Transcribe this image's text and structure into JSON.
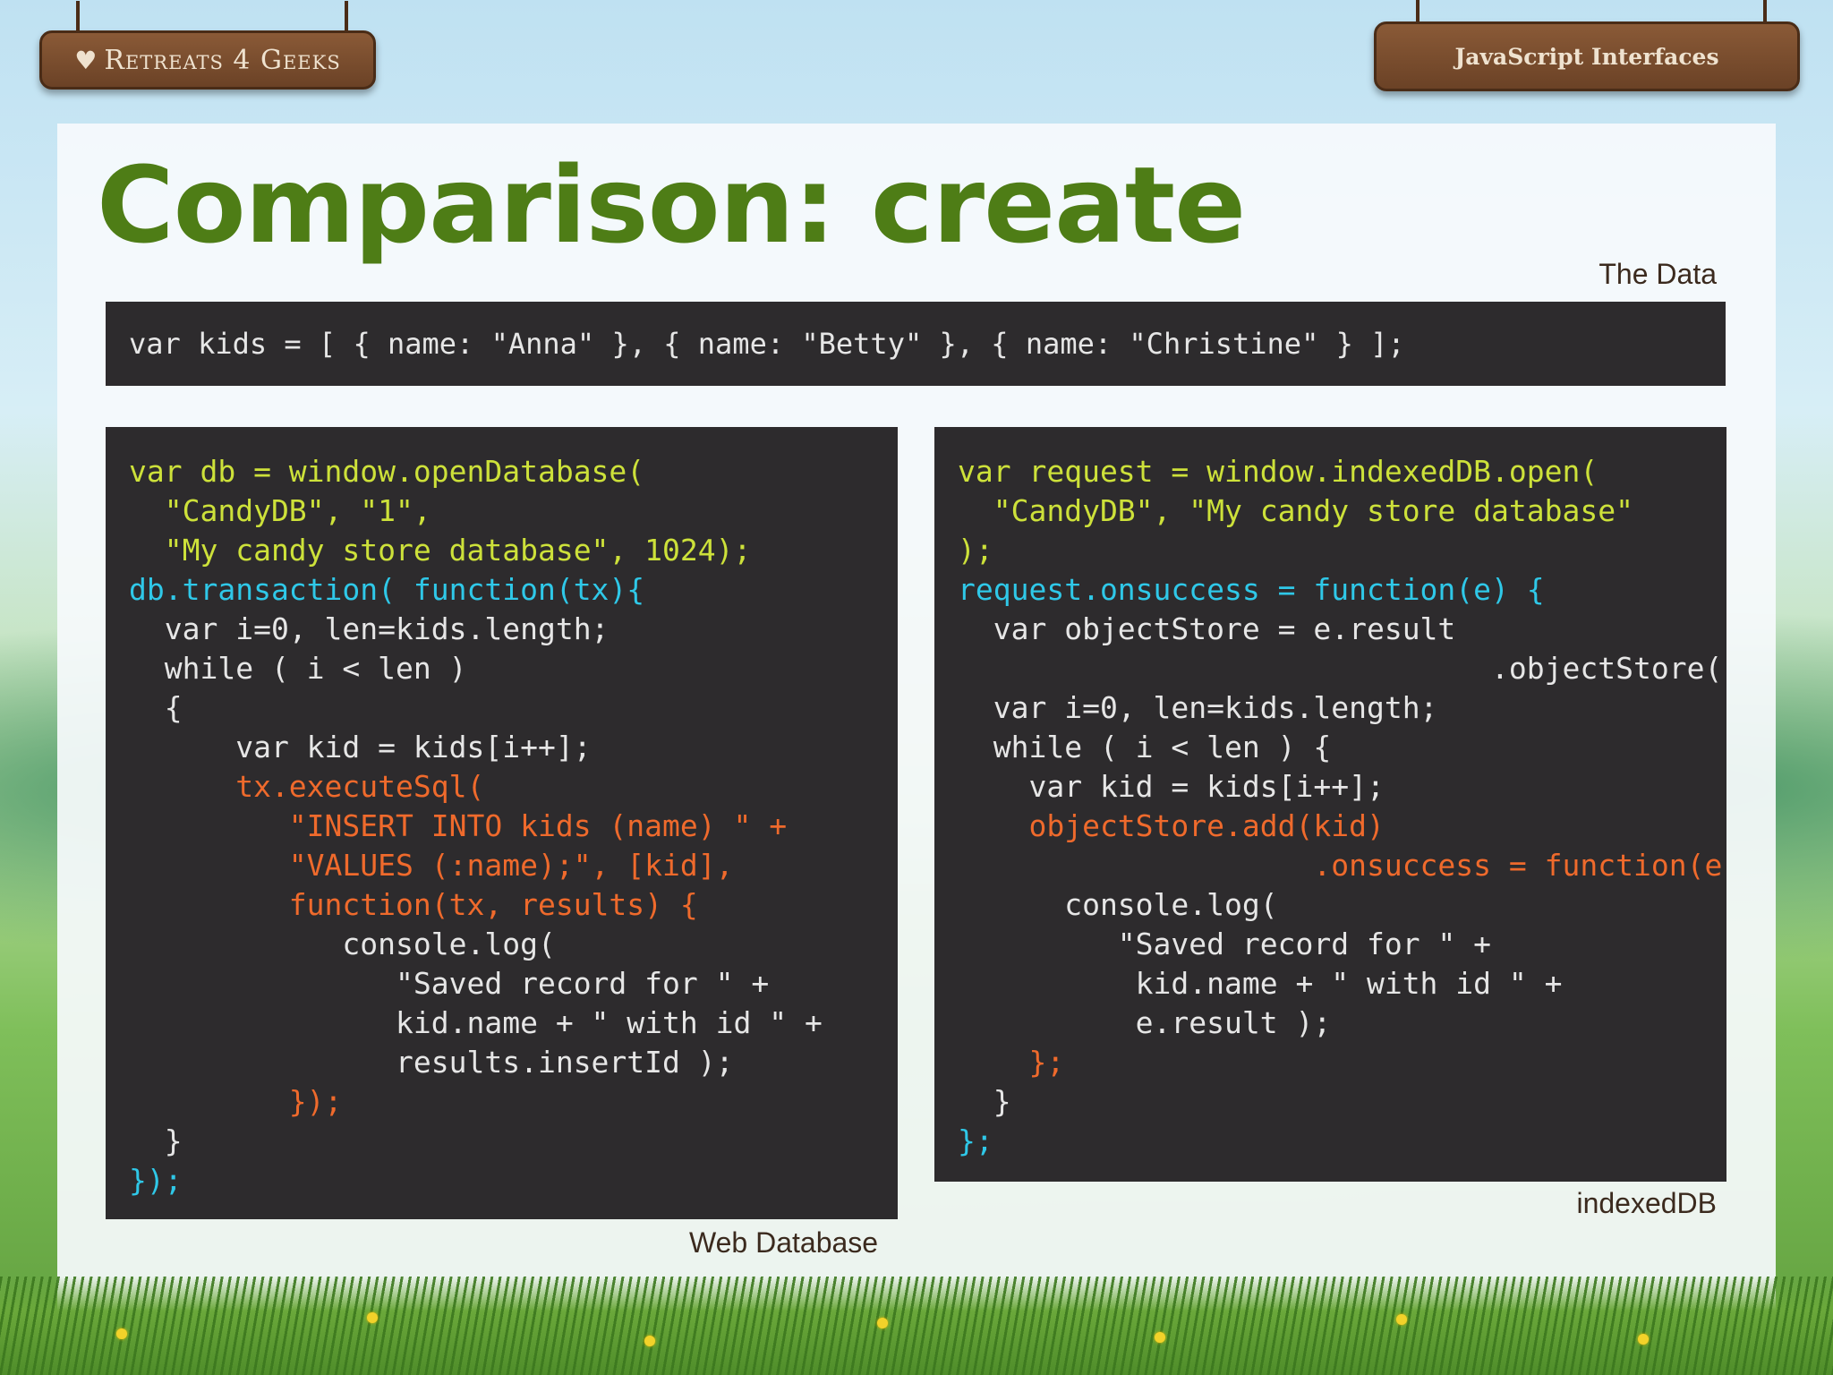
{
  "header": {
    "logo_text": "Retreats 4 Geeks",
    "topic": "JavaScript Interfaces"
  },
  "slide": {
    "title": "Comparison: create",
    "caption_data": "The Data",
    "caption_web": "Web Database",
    "caption_idb": "indexedDB"
  },
  "code_data": {
    "line": "var kids = [ { name: \"Anna\" }, { name: \"Betty\" }, { name: \"Christine\" } ];"
  },
  "code_web": {
    "lines": [
      "var db = window.openDatabase(",
      "  \"CandyDB\", \"1\",",
      "  \"My candy store database\", 1024);",
      "db.transaction( function(tx){",
      "  var i=0, len=kids.length;",
      "  while ( i < len )",
      "  {",
      "      var kid = kids[i++];",
      "      tx.executeSql(",
      "         \"INSERT INTO kids (name) \" +",
      "         \"VALUES (:name);\", [kid],",
      "         function(tx, results) {",
      "            console.log(",
      "               \"Saved record for \" +",
      "               kid.name + \" with id \" +",
      "               results.insertId );",
      "         });",
      "  }",
      "});"
    ]
  },
  "code_idb": {
    "lines": [
      "var request = window.indexedDB.open(",
      "  \"CandyDB\", \"My candy store database\"",
      ");",
      "request.onsuccess = function(e) {",
      "  var objectStore = e.result",
      "                              .objectStore(\"kids\"),",
      "  var i=0, len=kids.length;",
      "  while ( i < len ) {",
      "    var kid = kids[i++];",
      "    objectStore.add(kid)",
      "                    .onsuccess = function(e) {",
      "      console.log(",
      "         \"Saved record for \" +",
      "          kid.name + \" with id \" +",
      "          e.result );",
      "    };",
      "  }",
      "};"
    ]
  },
  "colors": {
    "title_green": "#4e7d16",
    "code_background": "#2d2b2d",
    "code_yellow_green": "#cde13a",
    "code_cyan": "#2fc8e8",
    "code_orange": "#ef6a2c",
    "code_white": "#e6e6e6",
    "sign_wood": "#7a4b2c"
  },
  "icons": {
    "logo": "heart-icon"
  }
}
